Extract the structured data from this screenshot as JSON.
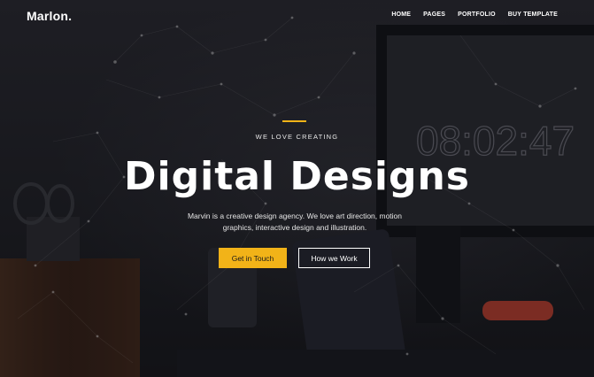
{
  "brand": {
    "logo": "Marlon."
  },
  "nav": {
    "items": [
      {
        "label": "HOME"
      },
      {
        "label": "PAGES"
      },
      {
        "label": "PORTFOLIO"
      },
      {
        "label": "BUY TEMPLATE"
      }
    ]
  },
  "hero": {
    "eyebrow": "WE LOVE CREATING",
    "title": "Digital Designs",
    "description_line1": "Marvin is a creative design agency. We love art direction, motion",
    "description_line2": "graphics, interactive design and illustration.",
    "primary_button": "Get in Touch",
    "secondary_button": "How we Work",
    "clock_text": "08:02:47"
  },
  "colors": {
    "accent": "#f2b318",
    "background": "#1f2024",
    "text": "#ffffff"
  }
}
